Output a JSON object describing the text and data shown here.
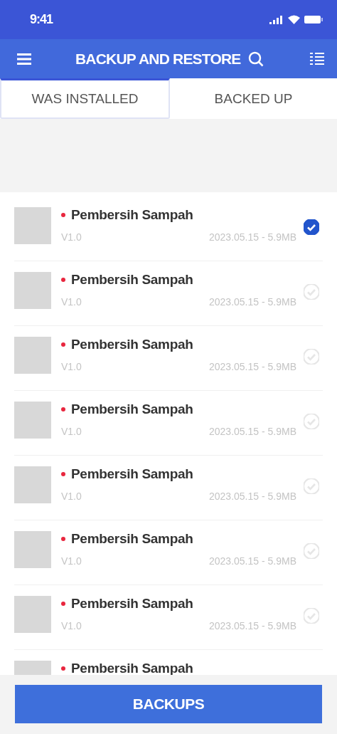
{
  "status_bar": {
    "time": "9:41"
  },
  "toolbar": {
    "title": "BACKUP AND RESTORE"
  },
  "tabs": [
    {
      "label": "WAS INSTALLED",
      "selected": true
    },
    {
      "label": "BACKED UP",
      "selected": false
    }
  ],
  "apps": [
    {
      "name": "Pembersih Sampah",
      "version": "V1.0",
      "meta": "2023.05.15 - 5.9MB",
      "selected": true
    },
    {
      "name": "Pembersih Sampah",
      "version": "V1.0",
      "meta": "2023.05.15 - 5.9MB",
      "selected": false
    },
    {
      "name": "Pembersih Sampah",
      "version": "V1.0",
      "meta": "2023.05.15 - 5.9MB",
      "selected": false
    },
    {
      "name": "Pembersih Sampah",
      "version": "V1.0",
      "meta": "2023.05.15 - 5.9MB",
      "selected": false
    },
    {
      "name": "Pembersih Sampah",
      "version": "V1.0",
      "meta": "2023.05.15 - 5.9MB",
      "selected": false
    },
    {
      "name": "Pembersih Sampah",
      "version": "V1.0",
      "meta": "2023.05.15 - 5.9MB",
      "selected": false
    },
    {
      "name": "Pembersih Sampah",
      "version": "V1.0",
      "meta": "2023.05.15 - 5.9MB",
      "selected": false
    },
    {
      "name": "Pembersih Sampah"
    }
  ],
  "footer": {
    "button": "BACKUPS"
  }
}
